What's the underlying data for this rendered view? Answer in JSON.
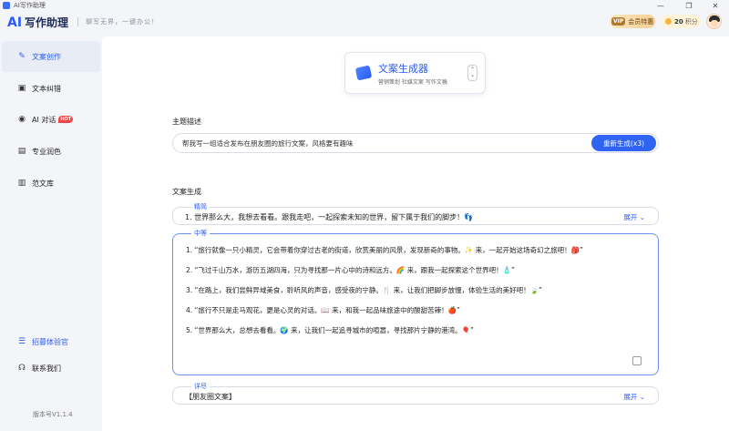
{
  "window": {
    "title": "AI写作助理",
    "minimize": "—",
    "maximize": "❐",
    "close": "✕"
  },
  "brand": {
    "ai": "AI",
    "name": "写作助理",
    "slogan": "聊写无界，一键办公！"
  },
  "header": {
    "vip_tag": "VIP",
    "vip_label": "会员特惠",
    "points_value": "20",
    "points_unit": "积分"
  },
  "sidebar": {
    "items": [
      {
        "label": "文案创作",
        "icon": "pen-icon"
      },
      {
        "label": "文本纠错",
        "icon": "edit-doc-icon"
      },
      {
        "label": "AI 对话",
        "icon": "eye-chat-icon",
        "badge": "HOT"
      },
      {
        "label": "专业润色",
        "icon": "polish-icon"
      },
      {
        "label": "范文库",
        "icon": "library-icon"
      }
    ],
    "recruit": "招募体验官",
    "contact": "联系我们",
    "version": "版本号V1.1.4"
  },
  "generator": {
    "title": "文案生成器",
    "subtitle": "营销策划 社媒文案 写作文稿"
  },
  "topic": {
    "label": "主题描述",
    "value": "帮我写一组适合发布在朋友圈的旅行文案，风格要有趣味",
    "button": "重新生成(x3)"
  },
  "output": {
    "label": "文案生成",
    "concise": {
      "label": "精简",
      "content": "1. 世界那么大，我想去看看。跟我走吧，一起探索未知的世界，留下属于我们的脚步！👣",
      "expand": "展开 ⌄"
    },
    "medium": {
      "label": "中等",
      "lines": [
        "1. “旅行就像一只小精灵，它会带着你穿过古老的街道，欣赏美丽的风景，发现新奇的事物。✨ 来，一起开始这场奇幻之旅吧！🎒”",
        "2. “飞过千山万水，游历五湖四海，只为寻找那一片心中的诗和远方。🌈 来，跟我一起探索这个世界吧！🧴”",
        "3. “在路上，我们尝鲜异域美食，聆听风的声音，感受夜的宁静。🍴 来，让我们把脚步放慢，体验生活的美好吧！🍃”",
        "4. “旅行不只是走马观花，更是心灵的对话。📖 来，和我一起品味旅途中的酸甜苦辣！🍎”",
        "5. “世界那么大，总想去看看。🌍 来，让我们一起追寻城市的喧嚣，寻找那片宁静的港湾。🎈”"
      ]
    },
    "detailed": {
      "label": "详尽",
      "content": "【朋友圈文案】",
      "expand": "展开 ⌄"
    }
  }
}
